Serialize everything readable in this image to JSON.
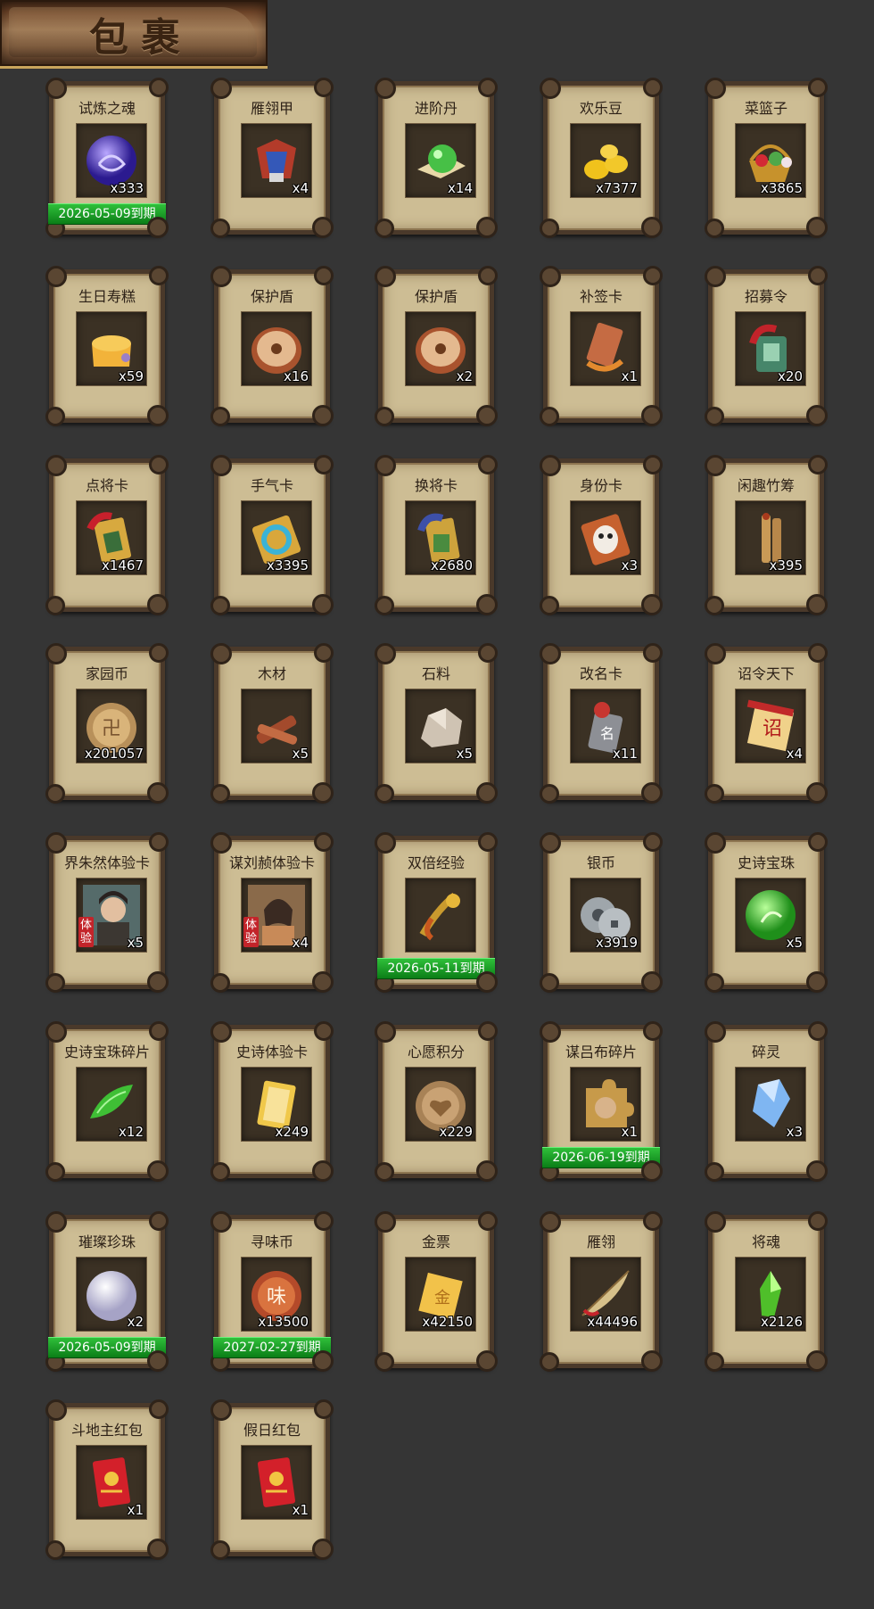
{
  "header": {
    "title": "包裹"
  },
  "colors": {
    "expiry_bar": "#1a9a26",
    "card_bg": "#cdbd94",
    "page_bg": "#353535"
  },
  "items": [
    {
      "name": "试炼之魂",
      "count": "x333",
      "expiry": "2026-05-09到期",
      "icon": "soul-orb-icon"
    },
    {
      "name": "雁翎甲",
      "count": "x4",
      "expiry": "",
      "icon": "armor-icon"
    },
    {
      "name": "进阶丹",
      "count": "x14",
      "expiry": "",
      "icon": "pill-icon"
    },
    {
      "name": "欢乐豆",
      "count": "x7377",
      "expiry": "",
      "icon": "beans-icon"
    },
    {
      "name": "菜篮子",
      "count": "x3865",
      "expiry": "",
      "icon": "basket-icon"
    },
    {
      "name": "生日寿糕",
      "count": "x59",
      "expiry": "",
      "icon": "cake-icon"
    },
    {
      "name": "保护盾",
      "count": "x16",
      "expiry": "",
      "icon": "shield-icon"
    },
    {
      "name": "保护盾",
      "count": "x2",
      "expiry": "",
      "icon": "shield-icon"
    },
    {
      "name": "补签卡",
      "count": "x1",
      "expiry": "",
      "icon": "sign-card-icon"
    },
    {
      "name": "招募令",
      "count": "x20",
      "expiry": "",
      "icon": "recruit-token-icon"
    },
    {
      "name": "点将卡",
      "count": "x1467",
      "expiry": "",
      "icon": "general-card-icon"
    },
    {
      "name": "手气卡",
      "count": "x3395",
      "expiry": "",
      "icon": "luck-card-icon"
    },
    {
      "name": "换将卡",
      "count": "x2680",
      "expiry": "",
      "icon": "swap-card-icon"
    },
    {
      "name": "身份卡",
      "count": "x3",
      "expiry": "",
      "icon": "identity-card-icon"
    },
    {
      "name": "闲趣竹筹",
      "count": "x395",
      "expiry": "",
      "icon": "bamboo-tally-icon"
    },
    {
      "name": "家园币",
      "count": "x201057",
      "expiry": "",
      "icon": "home-coin-icon"
    },
    {
      "name": "木材",
      "count": "x5",
      "expiry": "",
      "icon": "wood-icon"
    },
    {
      "name": "石料",
      "count": "x5",
      "expiry": "",
      "icon": "stone-icon"
    },
    {
      "name": "改名卡",
      "count": "x11",
      "expiry": "",
      "icon": "rename-card-icon"
    },
    {
      "name": "诏令天下",
      "count": "x4",
      "expiry": "",
      "icon": "edict-scroll-icon"
    },
    {
      "name": "界朱然体验卡",
      "count": "x5",
      "expiry": "",
      "icon": "hero-portrait-male-icon",
      "trial": "体验"
    },
    {
      "name": "谋刘赪体验卡",
      "count": "x4",
      "expiry": "",
      "icon": "hero-portrait-female-icon",
      "trial": "体验"
    },
    {
      "name": "双倍经验",
      "count": "",
      "expiry": "2026-05-11到期",
      "icon": "double-exp-icon"
    },
    {
      "name": "银币",
      "count": "x3919",
      "expiry": "",
      "icon": "silver-coin-icon"
    },
    {
      "name": "史诗宝珠",
      "count": "x5",
      "expiry": "",
      "icon": "green-orb-icon"
    },
    {
      "name": "史诗宝珠碎片",
      "count": "x12",
      "expiry": "",
      "icon": "orb-shard-icon"
    },
    {
      "name": "史诗体验卡",
      "count": "x249",
      "expiry": "",
      "icon": "epic-trial-card-icon"
    },
    {
      "name": "心愿积分",
      "count": "x229",
      "expiry": "",
      "icon": "wish-coin-icon"
    },
    {
      "name": "谋吕布碎片",
      "count": "x1",
      "expiry": "2026-06-19到期",
      "icon": "puzzle-piece-icon"
    },
    {
      "name": "碎灵",
      "count": "x3",
      "expiry": "",
      "icon": "crystal-icon"
    },
    {
      "name": "璀璨珍珠",
      "count": "x2",
      "expiry": "2026-05-09到期",
      "icon": "pearl-icon"
    },
    {
      "name": "寻味币",
      "count": "x13500",
      "expiry": "2027-02-27到期",
      "icon": "taste-coin-icon"
    },
    {
      "name": "金票",
      "count": "x42150",
      "expiry": "",
      "icon": "gold-ticket-icon"
    },
    {
      "name": "雁翎",
      "count": "x44496",
      "expiry": "",
      "icon": "feather-icon"
    },
    {
      "name": "将魂",
      "count": "x2126",
      "expiry": "",
      "icon": "general-soul-icon"
    },
    {
      "name": "斗地主红包",
      "count": "x1",
      "expiry": "",
      "icon": "red-envelope-icon"
    },
    {
      "name": "假日红包",
      "count": "x1",
      "expiry": "",
      "icon": "red-envelope-icon"
    }
  ]
}
